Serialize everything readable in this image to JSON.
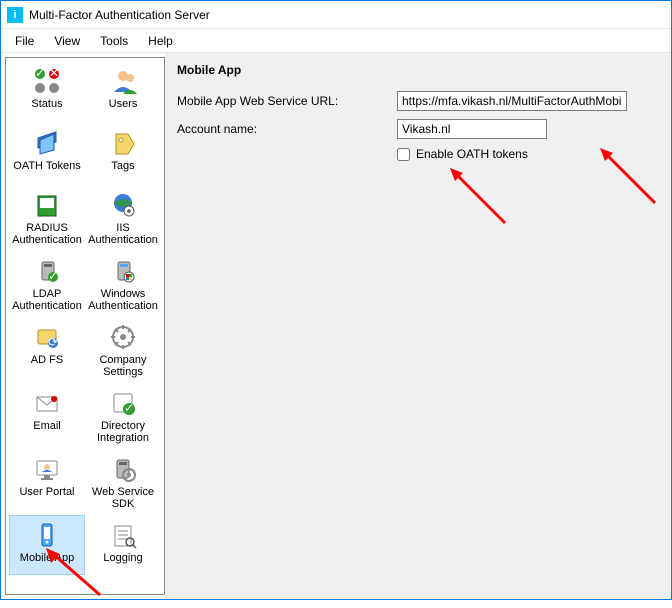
{
  "titlebar": {
    "title": "Multi-Factor Authentication Server"
  },
  "menubar": {
    "file": "File",
    "view": "View",
    "tools": "Tools",
    "help": "Help"
  },
  "sidebar": {
    "items": [
      {
        "label": "Status"
      },
      {
        "label": "Users"
      },
      {
        "label": "OATH Tokens"
      },
      {
        "label": "Tags"
      },
      {
        "label": "RADIUS\nAuthentication"
      },
      {
        "label": "IIS\nAuthentication"
      },
      {
        "label": "LDAP\nAuthentication"
      },
      {
        "label": "Windows\nAuthentication"
      },
      {
        "label": "AD FS"
      },
      {
        "label": "Company\nSettings"
      },
      {
        "label": "Email"
      },
      {
        "label": "Directory\nIntegration"
      },
      {
        "label": "User Portal"
      },
      {
        "label": "Web Service\nSDK"
      },
      {
        "label": "Mobile App"
      },
      {
        "label": "Logging"
      }
    ]
  },
  "main": {
    "heading": "Mobile App",
    "url_label": "Mobile App Web Service URL:",
    "url_value": "https://mfa.vikash.nl/MultiFactorAuthMobileAppWe",
    "account_label": "Account name:",
    "account_value": "Vikash.nl",
    "enable_oath_label": "Enable OATH tokens"
  }
}
